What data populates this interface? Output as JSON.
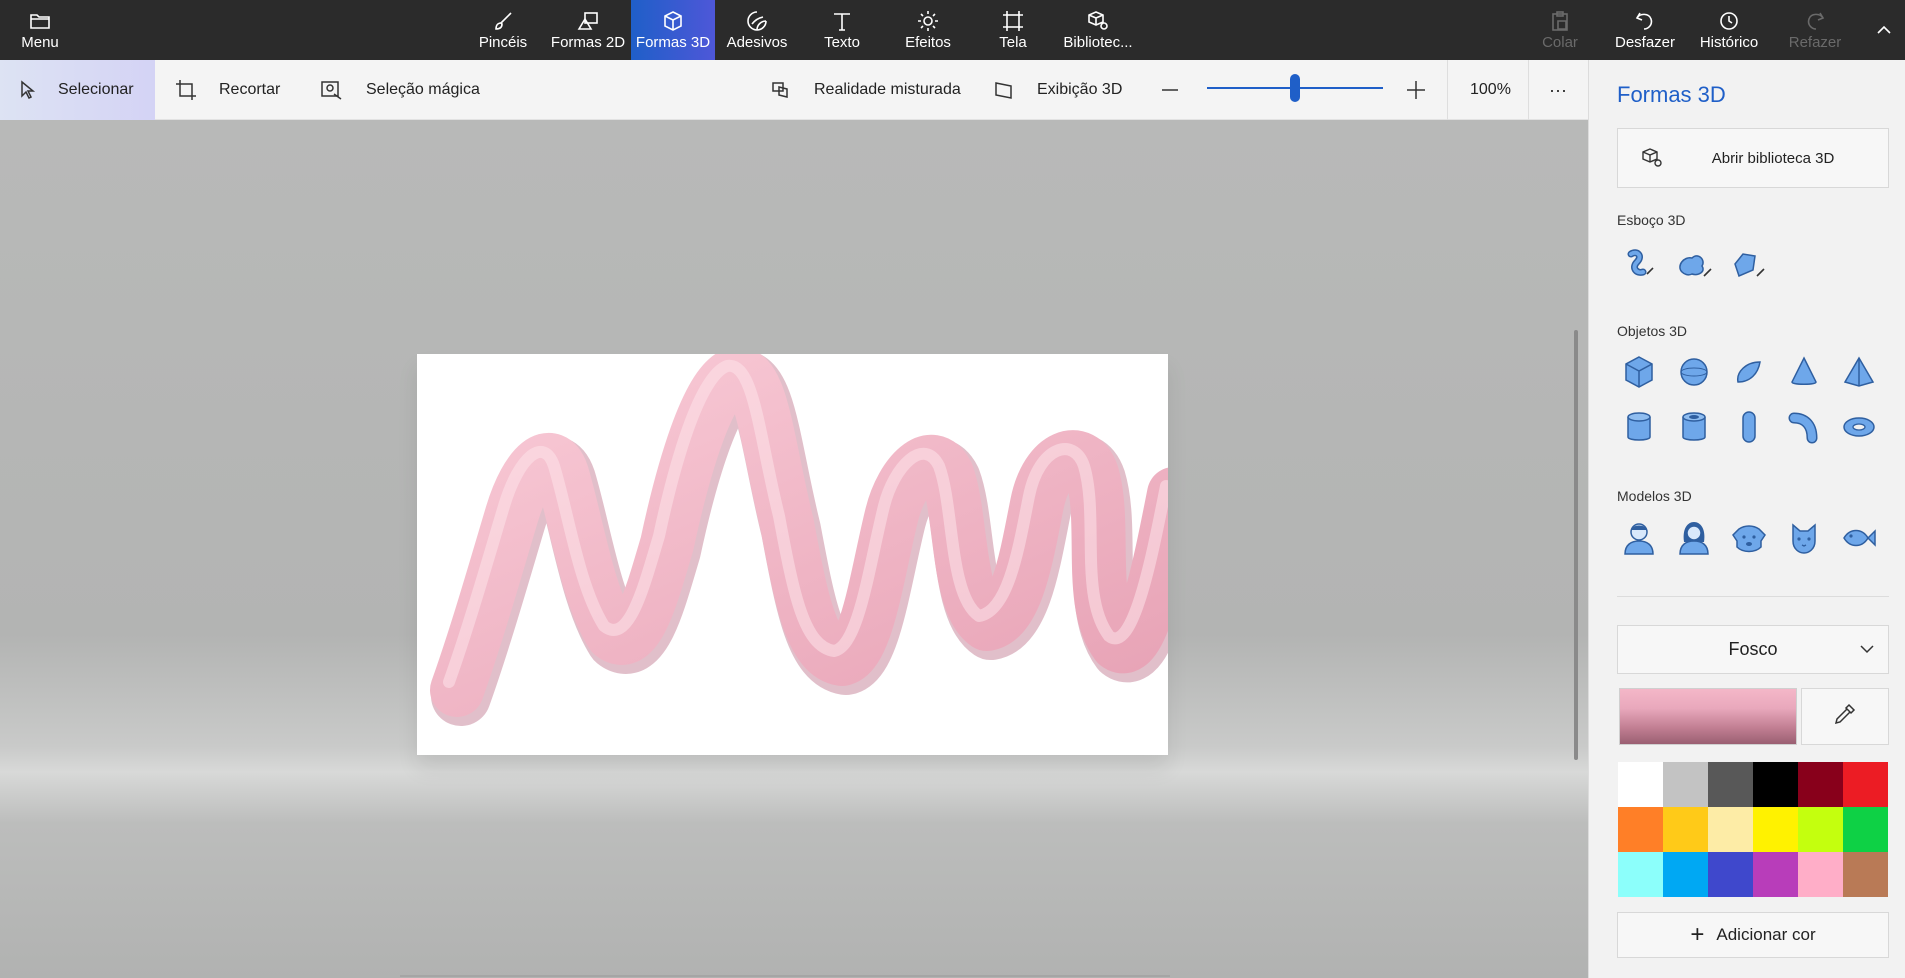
{
  "topbar": {
    "menu_label": "Menu",
    "tabs": [
      {
        "label": "Pincéis",
        "icon": "brush-icon"
      },
      {
        "label": "Formas 2D",
        "icon": "shapes-2d-icon"
      },
      {
        "label": "Formas 3D",
        "icon": "cube-icon",
        "active": true
      },
      {
        "label": "Adesivos",
        "icon": "sticker-icon"
      },
      {
        "label": "Texto",
        "icon": "text-icon"
      },
      {
        "label": "Efeitos",
        "icon": "sun-icon"
      },
      {
        "label": "Tela",
        "icon": "canvas-crop-icon"
      },
      {
        "label": "Bibliotec...",
        "icon": "library-3d-icon"
      }
    ],
    "actions": [
      {
        "label": "Colar",
        "icon": "paste-icon",
        "enabled": false
      },
      {
        "label": "Desfazer",
        "icon": "undo-icon",
        "enabled": true
      },
      {
        "label": "Histórico",
        "icon": "history-icon",
        "enabled": true
      },
      {
        "label": "Refazer",
        "icon": "redo-icon",
        "enabled": false
      }
    ],
    "collapse_icon": "chevron-up-icon"
  },
  "toolbar": {
    "select_label": "Selecionar",
    "crop_label": "Recortar",
    "magic_select_label": "Seleção mágica",
    "mixed_reality_label": "Realidade misturada",
    "view_3d_label": "Exibição 3D",
    "zoom_label": "100%",
    "zoom_level": 0.5,
    "more_label": "···"
  },
  "panel": {
    "title": "Formas 3D",
    "open_library_label": "Abrir biblioteca 3D",
    "sketch_title": "Esboço 3D",
    "sketch_tools": [
      "tube-sketch-icon",
      "soft-edge-sketch-icon",
      "sharp-edge-sketch-icon"
    ],
    "objects_title": "Objetos 3D",
    "objects": [
      "cube-icon",
      "sphere-icon",
      "hemisphere-icon",
      "cone-icon",
      "pyramid-icon",
      "cylinder-icon",
      "tube-icon",
      "capsule-icon",
      "elbow-pipe-icon",
      "donut-icon"
    ],
    "models_title": "Modelos 3D",
    "models": [
      "man-icon",
      "woman-icon",
      "dog-icon",
      "cat-icon",
      "fish-icon"
    ],
    "material_label": "Fosco",
    "selected_color": "#f0b3c6",
    "add_color_label": "Adicionar cor",
    "swatches": [
      "#ffffff",
      "#c3c3c3",
      "#585858",
      "#000000",
      "#88001b",
      "#ec1c24",
      "#ff7f27",
      "#ffca18",
      "#fdeca6",
      "#fff200",
      "#c4ff0e",
      "#0ed145",
      "#8cfffb",
      "#00a8f3",
      "#3f48cc",
      "#b83dba",
      "#ffaec8",
      "#b97a56"
    ]
  },
  "colors": {
    "accent": "#1f5fc8",
    "topbar": "#2b2b2b",
    "tube_pink": "#f4b8c9"
  }
}
